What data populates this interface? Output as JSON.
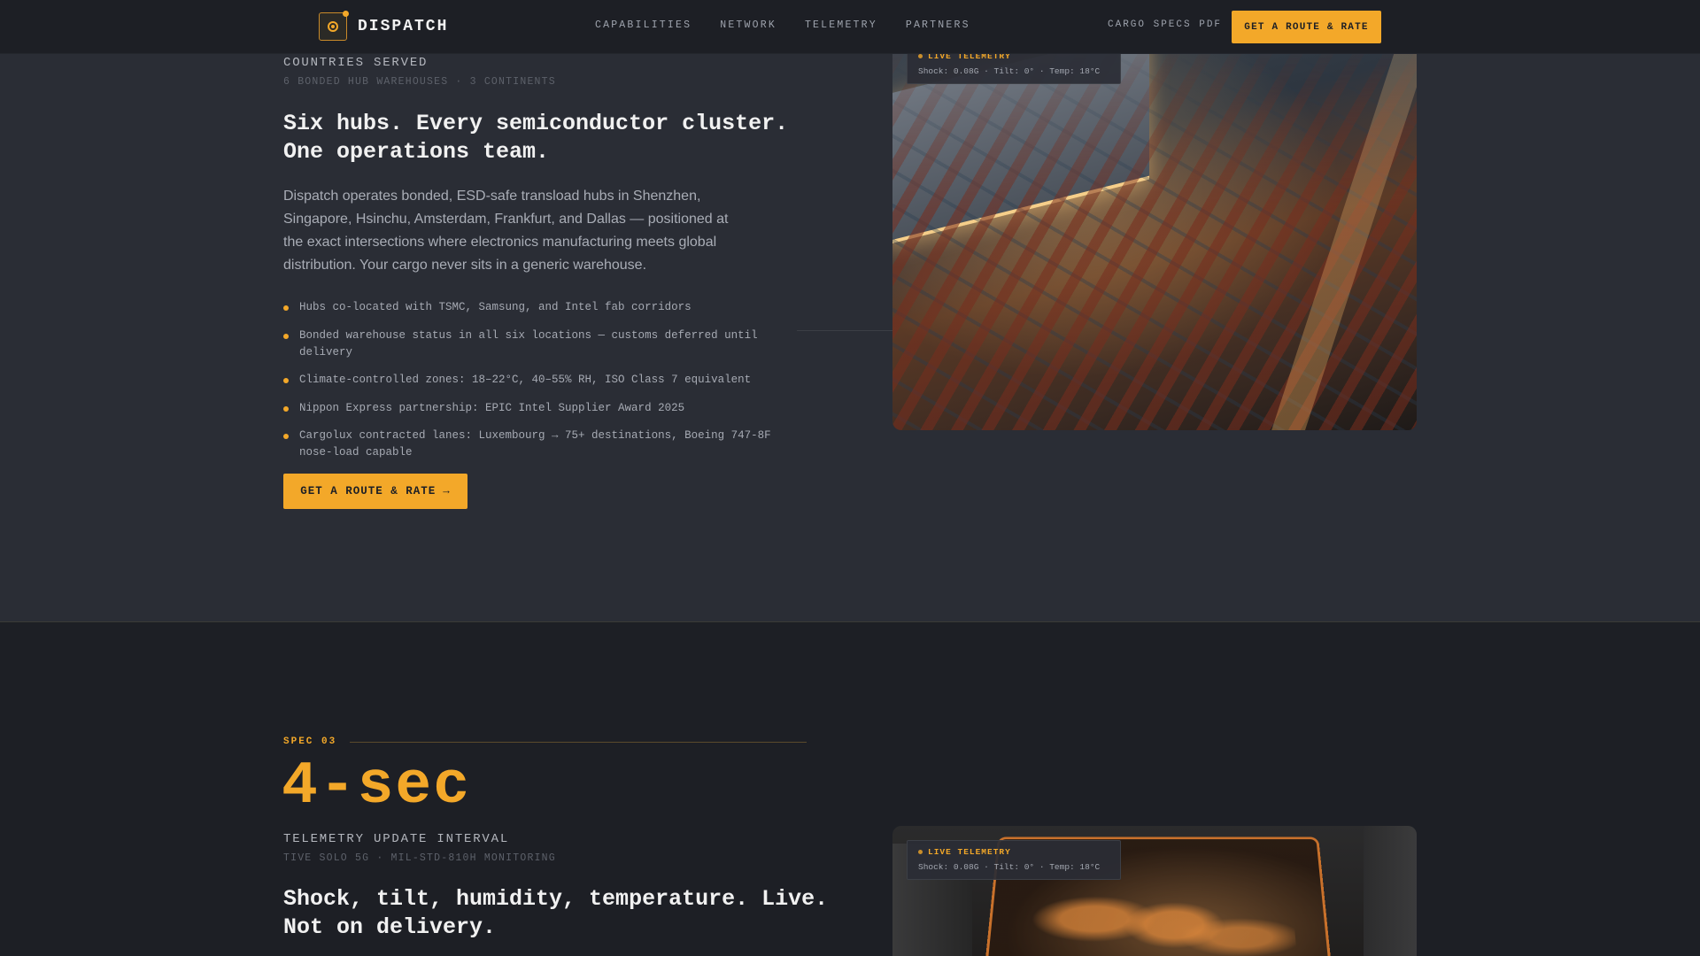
{
  "nav": {
    "brand": "DISPATCH",
    "links": [
      "CAPABILITIES",
      "NETWORK",
      "TELEMETRY",
      "PARTNERS"
    ],
    "pdf_link": "CARGO SPECS PDF",
    "cta": "GET A ROUTE & RATE"
  },
  "hubs_section": {
    "stat_label": "COUNTRIES SERVED",
    "stat_sub": "6 BONDED HUB WAREHOUSES · 3 CONTINENTS",
    "headline_line1": "Six hubs. Every semiconductor cluster.",
    "headline_line2": "One operations team.",
    "body": "Dispatch operates bonded, ESD-safe transload hubs in Shenzhen, Singapore, Hsinchu, Amsterdam, Frankfurt, and Dallas — positioned at the exact intersections where electronics manufacturing meets global distribution. Your cargo never sits in a generic warehouse.",
    "bullets": [
      "Hubs co-located with TSMC, Samsung, and Intel fab corridors",
      "Bonded warehouse status in all six locations — customs deferred until delivery",
      "Climate-controlled zones: 18–22°C, 40–55% RH, ISO Class 7 equivalent",
      "Nippon Express partnership: EPIC Intel Supplier Award 2025",
      "Cargolux contracted lanes: Luxembourg → 75+ destinations, Boeing 747-8F nose-load capable"
    ],
    "cta": "GET A ROUTE & RATE",
    "cta_arrow": "→",
    "telemetry": {
      "label": "LIVE TELEMETRY",
      "readout": "Shock: 0.08G · Tilt: 0° · Temp: 18°C"
    }
  },
  "telemetry_section": {
    "spec_tag": "SPEC 03",
    "big_value": "4-sec",
    "stat_label": "TELEMETRY UPDATE INTERVAL",
    "stat_sub": "TIVE SOLO 5G · MIL-STD-810H MONITORING",
    "headline_line1": "Shock, tilt, humidity, temperature. Live.",
    "headline_line2": "Not on delivery.",
    "telemetry": {
      "label": "LIVE TELEMETRY",
      "readout": "Shock: 0.08G · Tilt: 0° · Temp: 18°C"
    }
  },
  "colors": {
    "accent": "#f3a829",
    "nav_bg": "#1d1f25",
    "section_bg": "#2a2d35"
  }
}
